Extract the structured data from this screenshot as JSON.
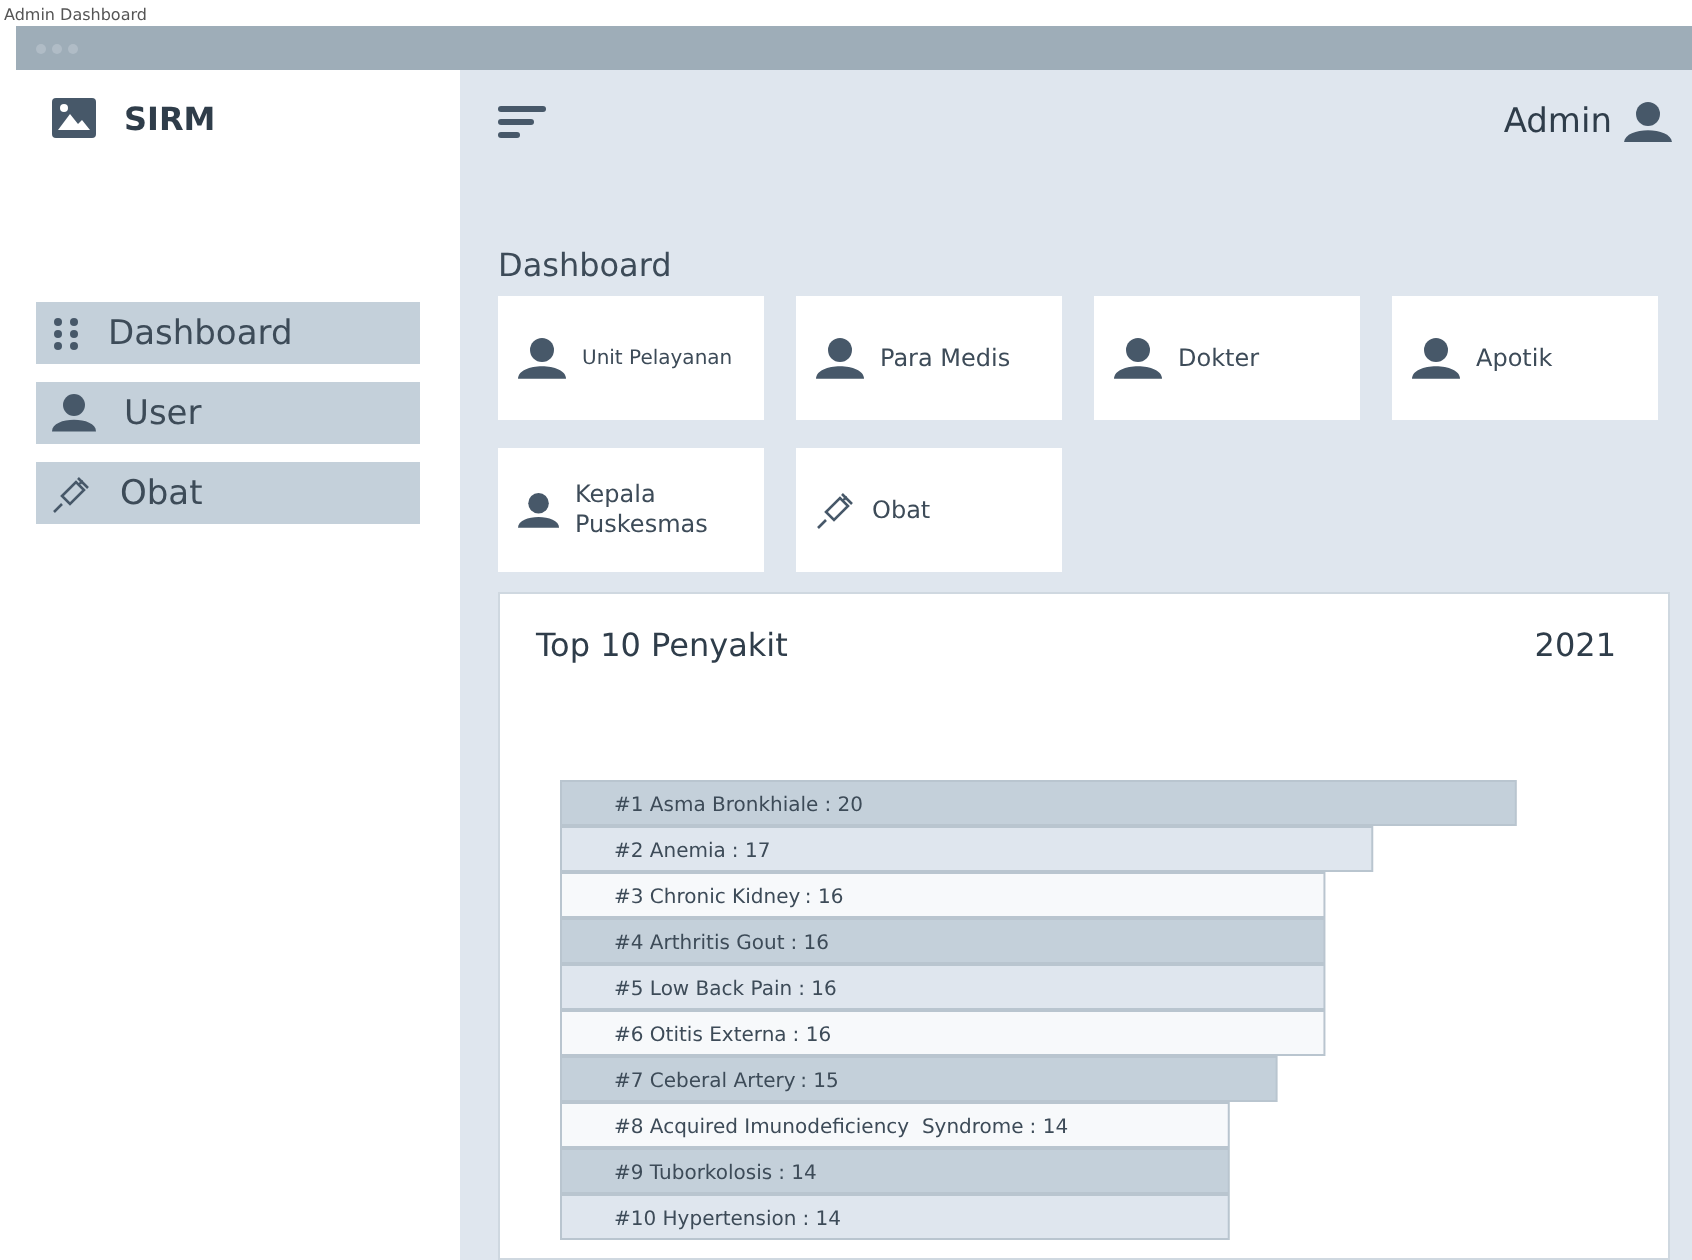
{
  "page_title": "Admin Dashboard",
  "sidebar": {
    "brand": "SIRM",
    "items": [
      {
        "label": "Dashboard",
        "kind": "grid",
        "selected": false
      },
      {
        "label": "User",
        "kind": "user",
        "selected": false
      },
      {
        "label": "Obat",
        "kind": "syringe",
        "selected": false
      }
    ]
  },
  "header": {
    "user": "Admin"
  },
  "section_title": "Dashboard",
  "cards": [
    {
      "label": "Unit Pelayanan",
      "kind": "user"
    },
    {
      "label": "Para Medis",
      "kind": "user"
    },
    {
      "label": "Dokter",
      "kind": "user"
    },
    {
      "label": "Apotik",
      "kind": "user"
    },
    {
      "label": "Kepala Puskesmas",
      "kind": "user"
    },
    {
      "label": "Obat",
      "kind": "syringe"
    }
  ],
  "panel": {
    "title": "Top 10 Penyakit",
    "year": "2021",
    "chart_data": {
      "type": "bar",
      "orientation": "horizontal",
      "categories": [
        "#1 Asma Bronkhiale",
        "#2 Anemia",
        "#3 Chronic Kidney",
        "#4 Arthritis Gout",
        "#5 Low Back Pain",
        "#6 Otitis Externa",
        "#7 Ceberal Artery",
        "#8 Acquired Imunodeficiency  Syndrome",
        "#9 Tuborkolosis",
        "#10 Hypertension"
      ],
      "value_labels": [
        ": 20",
        ": 17",
        ": 16",
        ": 16",
        ": 16",
        ": 16",
        ": 15",
        ": 14",
        ": 14",
        ": 14"
      ],
      "values": [
        20,
        17,
        16,
        16,
        16,
        16,
        15,
        14,
        14,
        14
      ],
      "colors": [
        "#c4d0da",
        "#dfe6ee",
        "#f7f9fb",
        "#c4d0da",
        "#dfe6ee",
        "#f7f9fb",
        "#c4d0da",
        "#f7f9fb",
        "#c4d0da",
        "#dfe6ee"
      ]
    }
  }
}
